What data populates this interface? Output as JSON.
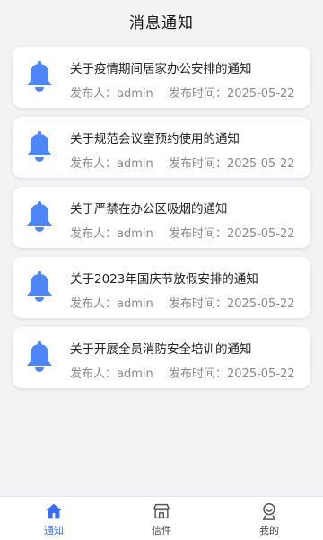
{
  "header": {
    "title": "消息通知"
  },
  "notices": [
    {
      "title": "关于疫情期间居家办公安排的通知",
      "publisher": "发布人：admin",
      "time": "发布时间：2025-05-22"
    },
    {
      "title": "关于规范会议室预约使用的通知",
      "publisher": "发布人：admin",
      "time": "发布时间：2025-05-22"
    },
    {
      "title": "关于严禁在办公区吸烟的通知",
      "publisher": "发布人：admin",
      "time": "发布时间：2025-05-22"
    },
    {
      "title": "关于2023年国庆节放假安排的通知",
      "publisher": "发布人：admin",
      "time": "发布时间：2025-05-22"
    },
    {
      "title": "关于开展全员消防安全培训的通知",
      "publisher": "发布人：admin",
      "time": "发布时间：2025-05-22"
    }
  ],
  "tabbar": {
    "items": [
      {
        "label": "通知",
        "icon": "home-icon",
        "active": true
      },
      {
        "label": "信件",
        "icon": "store-icon",
        "active": false
      },
      {
        "label": "我的",
        "icon": "user-icon",
        "active": false
      }
    ]
  },
  "colors": {
    "accent": "#3b6cf6",
    "bell": "#4f86f7"
  }
}
